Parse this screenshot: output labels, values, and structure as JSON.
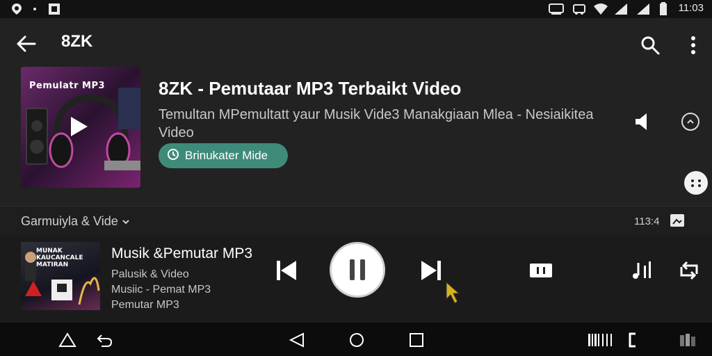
{
  "status_bar": {
    "time": "11:03",
    "icons": [
      "location-icon",
      "dot-icon",
      "notification-icon",
      "cast-icon",
      "car-icon",
      "wifi-icon",
      "signal-icon",
      "signal-icon",
      "battery-icon"
    ]
  },
  "app_bar": {
    "title": "8ZK",
    "icons": [
      "back-arrow-icon",
      "search-icon",
      "more-vert-icon"
    ]
  },
  "header": {
    "cover_text": "Pemulatr MP3",
    "title": "8ZK - Pemutaar MP3 Terbaikt Video",
    "subtitle": "Temultan MPemultatt yaur Musik Vide3 Manakgiaan Mlea - Nesiaikitea Video",
    "pill_label": "Brinukater Mide",
    "accent_color": "#3f8b7a"
  },
  "section": {
    "label": "Garmuiyla & Vide",
    "count": "113:4"
  },
  "player": {
    "thumb_text": "MUNAK KAUCANCALE MATIRAN",
    "title": "Musik &Pemutar MP3",
    "line1": "Palusik & Video",
    "line2": "Musiic - Pemat MP3",
    "line3": "Pemutar MP3"
  },
  "nav_bar": {
    "icons": [
      "triangle-icon",
      "undo-icon",
      "nav-back-icon",
      "home-icon",
      "recents-icon",
      "barcode-icon",
      "bracket-icon",
      "app-icon"
    ]
  }
}
